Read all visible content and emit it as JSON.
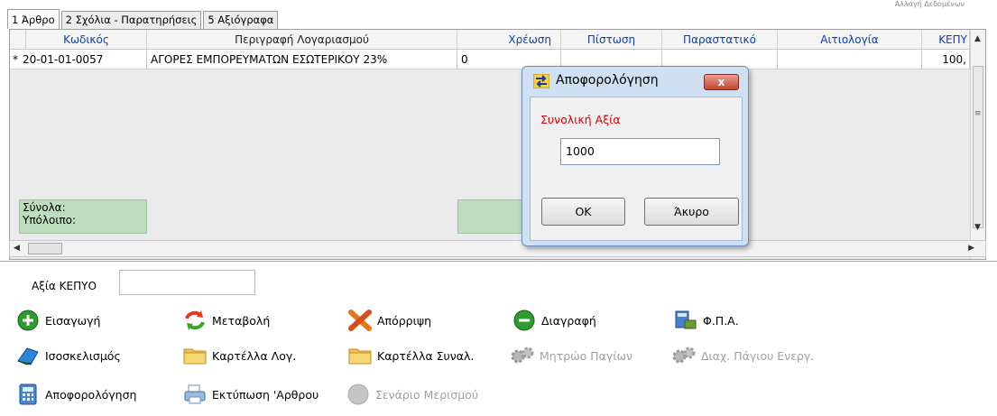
{
  "corner_text": "Αλλαγή Δεδομένων",
  "tabs": [
    {
      "label": "1 Άρθρο"
    },
    {
      "label": "2 Σχόλια - Παρατηρήσεις"
    },
    {
      "label": "5 Αξιόγραφα"
    }
  ],
  "grid": {
    "columns": [
      "Κωδικός",
      "Περιγραφή Λογαριασμού",
      "Χρέωση",
      "Πίστωση",
      "Παραστατικό",
      "Αιτιολογία",
      "ΚΕΠΥ"
    ],
    "row": {
      "marker": "*",
      "code": "20-01-01-0057",
      "description": "ΑΓΟΡΕΣ ΕΜΠΟΡΕΥΜΑΤΩΝ ΕΣΩΤΕΡΙΚΟΥ 23%",
      "debit": "0",
      "keptyo": "100,"
    },
    "totals_label": "Σύνολα:",
    "balance_label": "Υπόλοιπο:"
  },
  "bottom": {
    "keptyo_label": "Αξία ΚΕΠΥΟ",
    "keptyo_value": ""
  },
  "actions": {
    "insert": "Εισαγωγή",
    "modify": "Μεταβολή",
    "reject": "Απόρριψη",
    "delete": "Διαγραφή",
    "vat": "Φ.Π.Α.",
    "balance": "Ισοσκελισμός",
    "account_card": "Καρτέλλα Λογ.",
    "partner_card": "Καρτέλλα Συναλ.",
    "asset_register": "Μητρώο Παγίων",
    "asset_mgmt": "Διαχ. Πάγιου Ενεργ.",
    "tax_removal": "Αποφορολόγηση",
    "print_entry": "Εκτύπωση 'Αρθρου",
    "allocation": "Σενάριο Μερισμού"
  },
  "dialog": {
    "title": "Αποφορολόγηση",
    "close_label": "x",
    "field_label": "Συνολική Αξία",
    "field_value": "1000",
    "ok_label": "OK",
    "cancel_label": "Άκυρο"
  }
}
